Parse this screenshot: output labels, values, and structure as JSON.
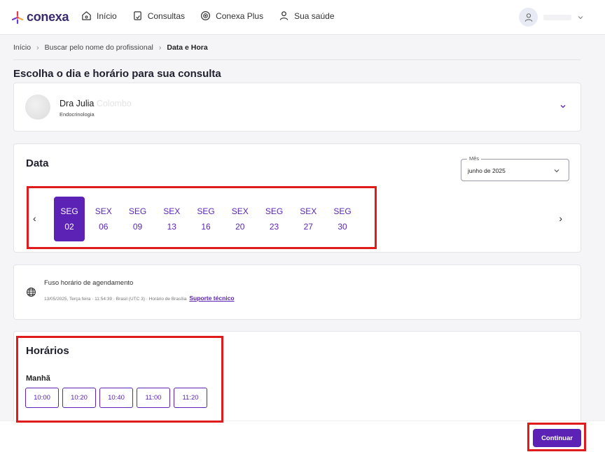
{
  "header": {
    "logo_text": "conexa",
    "nav": [
      {
        "label": "Início",
        "icon": "home-icon"
      },
      {
        "label": "Consultas",
        "icon": "clipboard-icon"
      },
      {
        "label": "Conexa Plus",
        "icon": "plus-circle-icon"
      },
      {
        "label": "Sua saúde",
        "icon": "person-icon"
      }
    ]
  },
  "breadcrumb": [
    "Início",
    "Buscar pelo nome do profissional",
    "Data e Hora"
  ],
  "page_title": "Escolha o dia e horário para sua consulta",
  "doctor": {
    "name": "Dra Julia",
    "name_faded": "Colombo",
    "specialty": "Endocrinologia"
  },
  "date_section": {
    "title": "Data",
    "month_label": "Mês",
    "month_value": "junho de 2025",
    "prev_arrow": "‹",
    "next_arrow": "›",
    "days": [
      {
        "weekday": "SEG",
        "day": "02",
        "selected": true
      },
      {
        "weekday": "SEX",
        "day": "06"
      },
      {
        "weekday": "SEG",
        "day": "09"
      },
      {
        "weekday": "SEX",
        "day": "13"
      },
      {
        "weekday": "SEG",
        "day": "16"
      },
      {
        "weekday": "SEX",
        "day": "20"
      },
      {
        "weekday": "SEG",
        "day": "23"
      },
      {
        "weekday": "SEX",
        "day": "27"
      },
      {
        "weekday": "SEG",
        "day": "30"
      }
    ]
  },
  "timezone": {
    "title": "Fuso horário de agendamento",
    "detail": "13/05/2025, Terça feira · 11:54:39 · Brasil (UTC 3) · Horário de Brasília",
    "support_link": "Suporte técnico"
  },
  "hours_section": {
    "title": "Horários",
    "period_label": "Manhã",
    "slots": [
      "10:00",
      "10:20",
      "10:40",
      "11:00",
      "11:20"
    ]
  },
  "footer": {
    "continue_label": "Continuar"
  },
  "colors": {
    "accent": "#5b22b5",
    "highlight": "#e01b1b"
  }
}
